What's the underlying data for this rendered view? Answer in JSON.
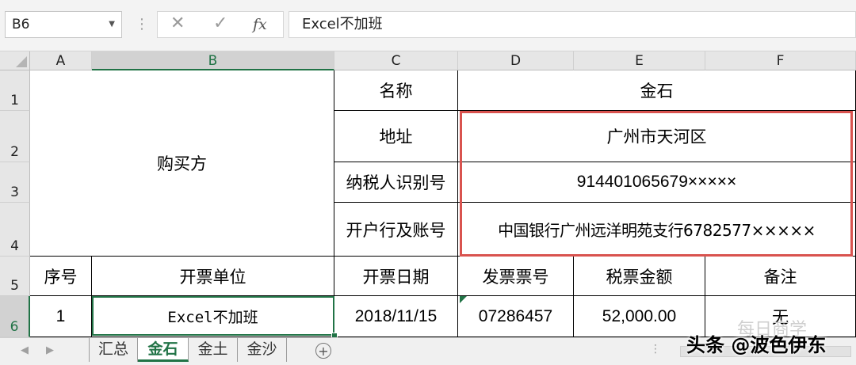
{
  "formula_bar": {
    "name_box": "B6",
    "formula": "Excel不加班"
  },
  "columns": [
    "A",
    "B",
    "C",
    "D",
    "E",
    "F"
  ],
  "rows": [
    "1",
    "2",
    "3",
    "4",
    "5",
    "6"
  ],
  "sheet": {
    "buyer_label": "购买方",
    "name_label": "名称",
    "name_value": "金石",
    "address_label": "地址",
    "address_value": "广州市天河区",
    "taxid_label": "纳税人识别号",
    "taxid_value": "914401065679×××××",
    "bank_label": "开户行及账号",
    "bank_value": "中国银行广州远洋明苑支行6782577×××××",
    "headers": [
      "序号",
      "开票单位",
      "开票日期",
      "发票票号",
      "税票金额",
      "备注"
    ],
    "row6": [
      "1",
      "Excel不加班",
      "2018/11/15",
      "07286457",
      "52,000.00",
      "无"
    ]
  },
  "tabs": [
    "汇总",
    "金石",
    "金土",
    "金沙"
  ],
  "active_tab": "金石",
  "watermark": "头条 @波色伊东",
  "watermark_faint": "每日商学",
  "colors": {
    "accent": "#217346",
    "highlight_box": "#d9534f"
  }
}
